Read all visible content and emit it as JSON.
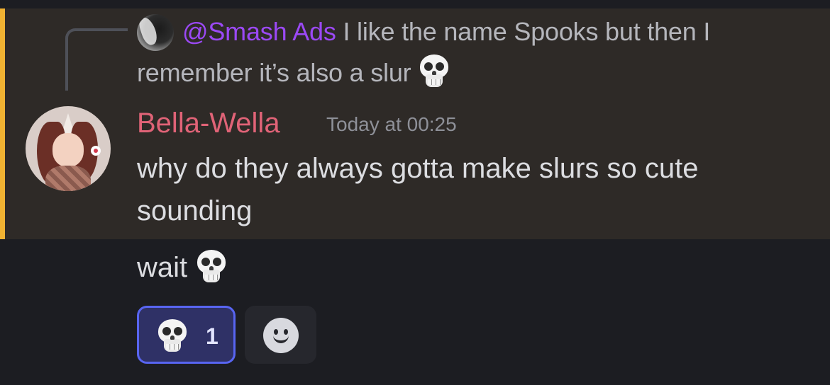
{
  "reply": {
    "mention": "@Smash Ads",
    "text": "I like the name Spooks but then I remember it’s also a slur",
    "emoji": "skull-emoji"
  },
  "message": {
    "author": "Bella-Wella",
    "timestamp": "Today at 00:25",
    "text": "why do they always gotta make slurs so cute sounding",
    "followup": "wait",
    "followup_emoji": "skull-emoji"
  },
  "reactions": [
    {
      "emoji": "skull-emoji",
      "count": "1",
      "selected": true
    }
  ],
  "add_reaction_icon": "smiley-face-icon",
  "colors": {
    "background": "#1c1d22",
    "mention_highlight": "#2e2a27",
    "mention_bar": "#f0b232",
    "mention_text": "#9b49f5",
    "author_name": "#e06377",
    "reaction_border": "#5865f2",
    "reaction_bg": "#2f3166"
  }
}
